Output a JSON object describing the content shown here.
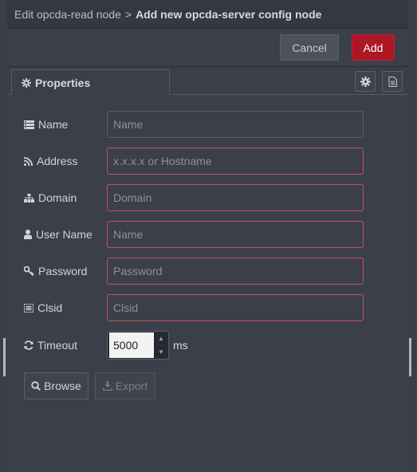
{
  "header": {
    "breadcrumb_parent": "Edit opcda-read node",
    "separator": ">",
    "title": "Add new opcda-server config node"
  },
  "actions": {
    "cancel_label": "Cancel",
    "add_label": "Add"
  },
  "tabs": {
    "properties_label": "Properties"
  },
  "form": {
    "name": {
      "label": "Name",
      "placeholder": "Name",
      "value": ""
    },
    "address": {
      "label": "Address",
      "placeholder": "x.x.x.x or Hostname",
      "value": ""
    },
    "domain": {
      "label": "Domain",
      "placeholder": "Domain",
      "value": ""
    },
    "username": {
      "label": "User Name",
      "placeholder": "Name",
      "value": ""
    },
    "password": {
      "label": "Password",
      "placeholder": "Password",
      "value": ""
    },
    "clsid": {
      "label": "Clsid",
      "placeholder": "Clsid",
      "value": ""
    },
    "timeout": {
      "label": "Timeout",
      "value": "5000",
      "unit": "ms"
    }
  },
  "buttons": {
    "browse_label": "Browse",
    "export_label": "Export"
  },
  "colors": {
    "add_button": "#ad1625",
    "invalid_border": "#c45260",
    "panel_bg": "#3b3f4a",
    "header_bg": "#343841"
  },
  "icons": [
    "cog-icon",
    "file-text-icon",
    "name-tag-icon",
    "rss-icon",
    "sitemap-icon",
    "user-icon",
    "key-icon",
    "list-icon",
    "refresh-icon",
    "search-icon",
    "download-icon"
  ]
}
